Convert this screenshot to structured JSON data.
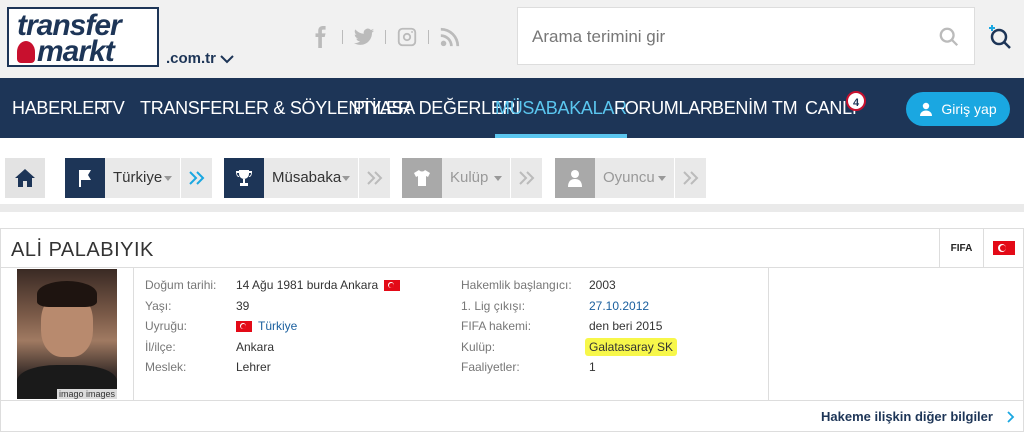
{
  "header": {
    "logo_line1": "transfer",
    "logo_line2": "markt",
    "domain": ".com.tr",
    "search_placeholder": "Arama terimini gir"
  },
  "nav": {
    "items": [
      "HABERLER",
      "TV",
      "TRANSFERLER & SÖYLENTİLER",
      "PİYASA DEĞERLERİ",
      "MÜSABAKALAR",
      "FORUMLAR",
      "BENİM TM",
      "CANLI"
    ],
    "active": "MÜSABAKALAR",
    "live_badge": "4",
    "login_label": "Giriş yap"
  },
  "breadcrumb": {
    "items": [
      {
        "label": "Türkiye",
        "icon": "flag-icon",
        "active": true
      },
      {
        "label": "Müsabaka",
        "icon": "trophy-icon",
        "active": true
      },
      {
        "label": "Kulüp",
        "icon": "shirt-icon",
        "active": false
      },
      {
        "label": "Oyuncu",
        "icon": "person-icon",
        "active": false
      }
    ]
  },
  "referee": {
    "name": "ALİ PALABIYIK",
    "fifa_label": "FIFA",
    "photo_credit": "imago images",
    "left": [
      {
        "label": "Doğum tarihi:",
        "value": "14 Ağu 1981 burda Ankara"
      },
      {
        "label": "Yaşı:",
        "value": "39"
      },
      {
        "label": "Uyruğu:",
        "value": "Türkiye"
      },
      {
        "label": "İl/ilçe:",
        "value": "Ankara"
      },
      {
        "label": "Meslek:",
        "value": "Lehrer"
      }
    ],
    "right": [
      {
        "label": "Hakemlik başlangıcı:",
        "value": "2003"
      },
      {
        "label": "1. Lig çıkışı:",
        "value": "27.10.2012"
      },
      {
        "label": "FIFA hakemi:",
        "value": "den beri 2015"
      },
      {
        "label": "Kulüp:",
        "value": "Galatasaray SK"
      },
      {
        "label": "Faaliyetler:",
        "value": "1"
      }
    ],
    "more_link": "Hakeme ilişkin diğer bilgiler"
  },
  "colors": {
    "navy": "#1d3557",
    "accent": "#5bc6ef",
    "login": "#1aa7e1",
    "highlight": "#f7f74a"
  }
}
